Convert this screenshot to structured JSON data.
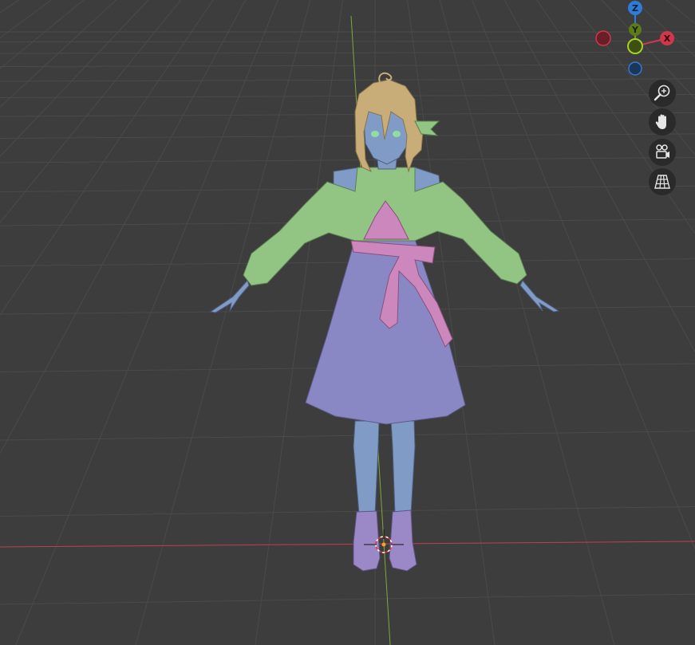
{
  "viewport": {
    "background": "#3d3d3d",
    "grid_color": "#4a4a4a",
    "x_axis_color": "#c0404c",
    "y_axis_color": "#7fa83a"
  },
  "gizmo": {
    "x_label": "X",
    "y_label": "Y",
    "z_label": "Z",
    "x_color": "#d1374c",
    "y_color": "#7a9d22",
    "z_color": "#2f7bd8"
  },
  "nav_buttons": [
    {
      "name": "zoom",
      "icon": "zoom-in-icon"
    },
    {
      "name": "pan",
      "icon": "hand-icon"
    },
    {
      "name": "camera",
      "icon": "camera-icon"
    },
    {
      "name": "perspective",
      "icon": "grid-perspective-icon"
    }
  ],
  "model": {
    "hair_color": "#c9ad78",
    "skin_color": "#7f9bc6",
    "top_color": "#92c583",
    "skirt_color": "#8a88c4",
    "ribbon_color": "#cc87bd",
    "boots_color": "#9b88c6",
    "eye_color": "#8fe0a0"
  }
}
